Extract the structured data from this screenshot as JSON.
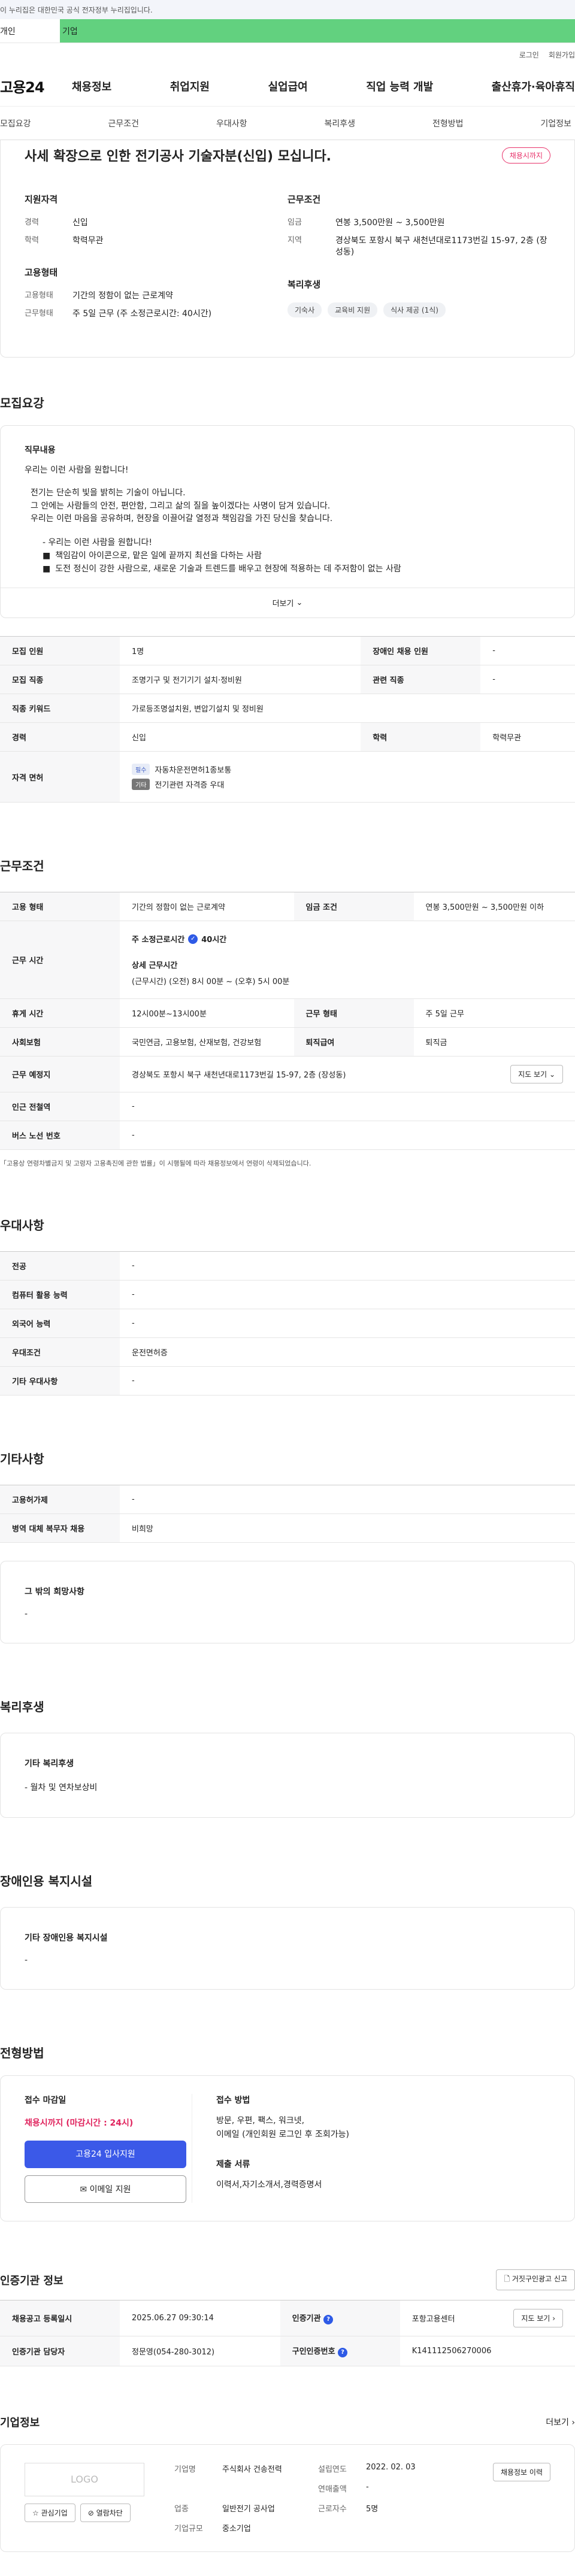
{
  "gov_notice": "이 누리집은 대한민국 공식 전자정부 누리집입니다.",
  "top_tabs": [
    "개인",
    "기업"
  ],
  "util": [
    "로그인",
    "회원가입"
  ],
  "logo": "고용24",
  "gnb": [
    "채용정보",
    "취업지원",
    "실업급여",
    "직업 능력 개발",
    "출산휴가·육아휴직"
  ],
  "subnav": [
    "모집요강",
    "근무조건",
    "우대사항",
    "복리후생",
    "전형방법",
    "기업정보"
  ],
  "summary": {
    "title": "사세 확장으로 인한 전기공사 기술자분(신입) 모십니다.",
    "status": "채용시까지",
    "qual_label": "지원자격",
    "cond_label": "근무조건",
    "career_k": "경력",
    "career_v": "신입",
    "edu_k": "학력",
    "edu_v": "학력무관",
    "wage_k": "임금",
    "wage_v": "연봉 3,500만원 ~ 3,500만원",
    "region_k": "지역",
    "region_v": "경상북도 포항시 북구 새천년대로1173번길 15-97, 2층 (장성동)",
    "emp_label": "고용형태",
    "emp_k": "고용형태",
    "emp_v": "기간의 정함이 없는 근로계약",
    "worktype_k": "근무형태",
    "worktype_v": "주 5일 근무 (주 소정근로시간: 40시간)",
    "welfare_label": "복리후생",
    "welfare_chips": [
      "기숙사",
      "교육비 지원",
      "식사 제공 (1식)"
    ]
  },
  "recruit": {
    "section": "모집요강",
    "duty_label": "직무내용",
    "intro": "우리는 이런 사람을 원합니다!",
    "para": "전기는 단순히 빛을 밝히는 기술이 아닙니다.\n그 안에는 사람들의 안전, 편안함, 그리고 삶의 질을 높이겠다는 사명이 담겨 있습니다.\n우리는 이런 마음을 공유하며, 현장을 이끌어갈 열정과 책임감을 가진 당신을 찾습니다.",
    "list_intro": "- 우리는 이런 사람을 원합니다!",
    "bullets": [
      "책임감이 아이콘으로, 맡은 일에 끝까지 최선을 다하는 사람",
      "도전 정신이 강한 사람으로, 새로운 기술과 트렌드를 배우고 현장에 적용하는 데 주저함이 없는 사람"
    ],
    "more": "더보기",
    "rows": {
      "count_k": "모집 인원",
      "count_v": "1명",
      "disabled_k": "장애인 채용 인원",
      "disabled_v": "-",
      "job_k": "모집 직종",
      "job_v": "조명기구 및 전기기기 설치·정비원",
      "related_k": "관련 직종",
      "related_v": "-",
      "keyword_k": "직종 키워드",
      "keyword_v": "가로등조명설치원, 변압기설치 및 정비원",
      "career_k": "경력",
      "career_v": "신입",
      "edu_k": "학력",
      "edu_v": "학력무관",
      "license_k": "자격 면허",
      "license_req_tag": "필수",
      "license_req": "자동차운전면허1종보통",
      "license_opt_tag": "기타",
      "license_opt": "전기관련 자격증 우대"
    }
  },
  "conditions": {
    "section": "근무조건",
    "emp_k": "고용 형태",
    "emp_v": "기간의 정함이 없는 근로계약",
    "wage_k": "임금 조건",
    "wage_v": "연봉 3,500만원 ~ 3,500만원 이하",
    "hours_k": "근무 시간",
    "hours_head": "주 소정근로시간",
    "hours_val": "40시간",
    "detail_label": "상세 근무시간",
    "detail_v": "(근무시간) (오전) 8시 00분 ~ (오후) 5시 00분",
    "break_k": "휴게 시간",
    "break_v": "12시00분~13시00분",
    "type_k": "근무 형태",
    "type_v": "주 5일 근무",
    "insure_k": "사회보험",
    "insure_v": "국민연금, 고용보험, 산재보험, 건강보험",
    "retire_k": "퇴직급여",
    "retire_v": "퇴직금",
    "place_k": "근무 예정지",
    "place_v": "경상북도 포항시 북구 새천년대로1173번길 15-97, 2층 (장성동)",
    "map_btn": "지도 보기",
    "subway_k": "인근 전철역",
    "subway_v": "-",
    "bus_k": "버스 노선 번호",
    "bus_v": "-",
    "note": "「고용상 연령차별금지 및 고령자 고용촉진에 관한 법률」이 시행될에 따라 채용정보에서 연령이 삭제되었습니다."
  },
  "pref": {
    "section": "우대사항",
    "major_k": "전공",
    "major_v": "-",
    "computer_k": "컴퓨터 활용 능력",
    "computer_v": "-",
    "lang_k": "외국어 능력",
    "lang_v": "-",
    "cond_k": "우대조건",
    "cond_v": "운전면허증",
    "etc_k": "기타 우대사항",
    "etc_v": "-"
  },
  "other": {
    "section": "기타사항",
    "reemp_k": "고용허가제",
    "reemp_v": "-",
    "military_k": "병역 대체 복무자 채용",
    "military_v": "비희망",
    "wish_label": "그 밖의 희망사항",
    "wish_v": "-"
  },
  "welfare": {
    "section": "복리후생",
    "label": "기타 복리후생",
    "value": "- 월차 및 연차보상비"
  },
  "disability": {
    "section": "장애인용 복지시설",
    "label": "기타 장애인용 복지시설",
    "value": "-"
  },
  "apply": {
    "section": "전형방법",
    "deadline_label": "접수 마감일",
    "deadline": "채용시까지 (마감시간 : 24시)",
    "apply_btn": "고용24 입사지원",
    "email_btn": "이메일 지원",
    "method_label": "접수 방법",
    "method_v": "방문, 우편, 팩스, 워크넷,\n이메일 (개인회원 로그인 후 조회가능)",
    "docs_label": "제출 서류",
    "docs_v": "이력서,자기소개서,경력증명서"
  },
  "agency": {
    "section": "인증기관 정보",
    "report_btn": "거짓구인광고 신고",
    "reg_k": "채용공고 등록일시",
    "reg_v": "2025.06.27 09:30:14",
    "org_k": "인증기관",
    "org_v": "포항고용센터",
    "map_btn": "지도 보기",
    "manager_k": "인증기관 담당자",
    "manager_v": "정문영(054-280-3012)",
    "num_k": "구인인증번호",
    "num_v": "K141112506270006"
  },
  "company": {
    "section": "기업정보",
    "more": "더보기",
    "logo_text": "LOGO",
    "interest_btn": "관심기업",
    "block_btn": "열람차단",
    "name_k": "기업명",
    "name_v": "주식회사 건송전력",
    "founded_k": "설립연도",
    "founded_v": "2022. 02. 03",
    "sales_k": "연매출액",
    "sales_v": "-",
    "industry_k": "업종",
    "industry_v": "일반전기 공사업",
    "scale_k": "기업규모",
    "scale_v": "중소기업",
    "employees_k": "근로자수",
    "employees_v": "5명",
    "jobs_btn": "채용정보 이력"
  }
}
